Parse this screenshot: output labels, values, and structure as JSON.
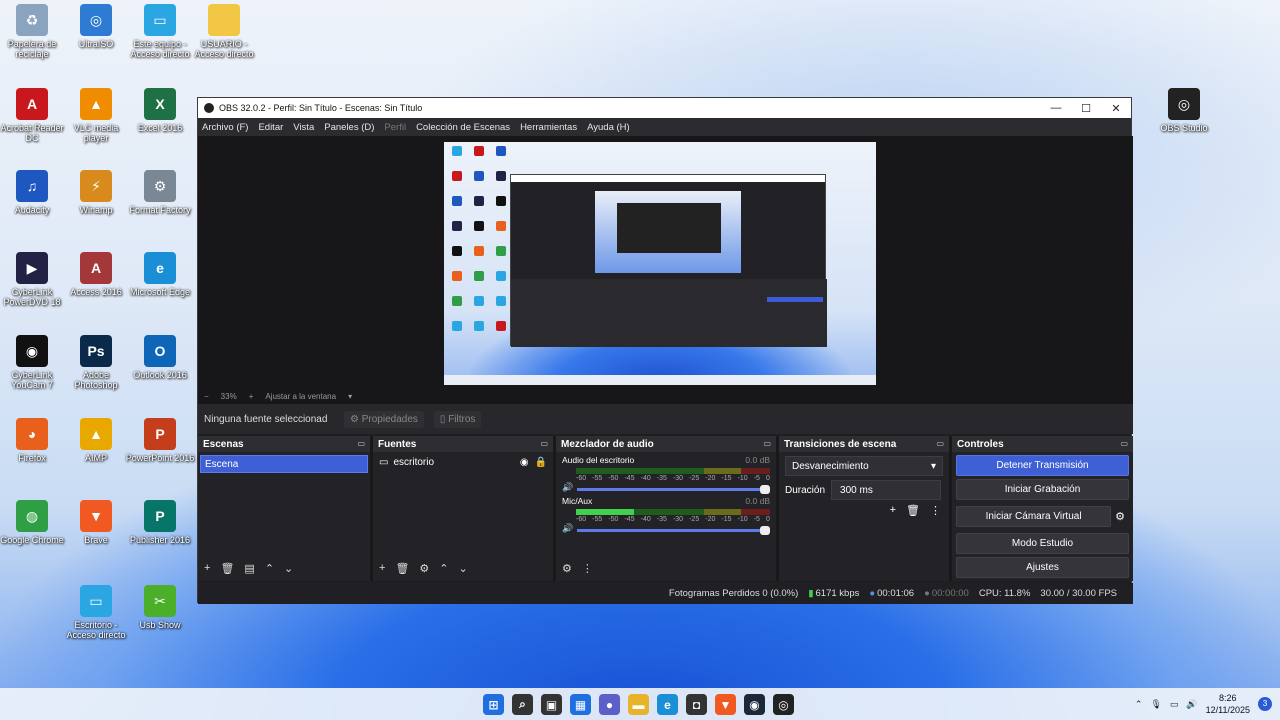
{
  "desktop": {
    "icons": [
      {
        "label": "Papelera de reciclaje",
        "icon": "recycle-bin-icon",
        "color": "#8aa4c0"
      },
      {
        "label": "UltraISO",
        "icon": "ultraiso-icon",
        "color": "#2e7bd4"
      },
      {
        "label": "Este equipo - Acceso directo",
        "icon": "monitor-icon",
        "color": "#2aa6e2"
      },
      {
        "label": "USUARIO - Acceso directo",
        "icon": "folder-icon",
        "color": "#f2c744"
      },
      {
        "label": "Acrobat Reader DC",
        "icon": "acrobat-icon",
        "color": "#c8171d"
      },
      {
        "label": "VLC media player",
        "icon": "vlc-icon",
        "color": "#f08c00"
      },
      {
        "label": "Excel 2016",
        "icon": "excel-icon",
        "color": "#1e7145"
      },
      {
        "label": "Audacity",
        "icon": "audacity-icon",
        "color": "#1f57c0"
      },
      {
        "label": "Winamp",
        "icon": "winamp-icon",
        "color": "#d98a1c"
      },
      {
        "label": "Format Factory",
        "icon": "format-factory-icon",
        "color": "#7a8795"
      },
      {
        "label": "CyberLink PowerDVD 18",
        "icon": "powerdvd-icon",
        "color": "#222244"
      },
      {
        "label": "Access 2016",
        "icon": "access-icon",
        "color": "#a4373a"
      },
      {
        "label": "Microsoft Edge",
        "icon": "edge-icon",
        "color": "#1b8fd6"
      },
      {
        "label": "CyberLink YouCam 7",
        "icon": "youcam-icon",
        "color": "#111111"
      },
      {
        "label": "Adobe Photoshop",
        "icon": "photoshop-icon",
        "color": "#0b2a4a"
      },
      {
        "label": "Outlook 2016",
        "icon": "outlook-icon",
        "color": "#0f65b8"
      },
      {
        "label": "Firefox",
        "icon": "firefox-icon",
        "color": "#e8601c"
      },
      {
        "label": "AIMP",
        "icon": "aimp-icon",
        "color": "#e9a800"
      },
      {
        "label": "PowerPoint 2016",
        "icon": "powerpoint-icon",
        "color": "#c43e1c"
      },
      {
        "label": "Google Chrome",
        "icon": "chrome-icon",
        "color": "#2f9e44"
      },
      {
        "label": "Brave",
        "icon": "brave-icon",
        "color": "#f05a22"
      },
      {
        "label": "Publisher 2016",
        "icon": "publisher-icon",
        "color": "#077568"
      },
      {
        "label": "Escritorio - Acceso directo",
        "icon": "desktop-folder-icon",
        "color": "#2aa6e2"
      },
      {
        "label": "Usb Show",
        "icon": "usb-show-icon",
        "color": "#4caf2a"
      },
      {
        "label": "OBS Studio",
        "icon": "obs-icon",
        "color": "#222222"
      }
    ]
  },
  "window": {
    "title": "OBS 32.0.2 - Perfil: Sin Título - Escenas: Sin Título",
    "minimize": "—",
    "maximize": "☐",
    "close": "✕"
  },
  "menu": [
    "Archivo (F)",
    "Editar",
    "Vista",
    "Paneles (D)",
    "Perfil",
    "Colección de Escenas",
    "Herramientas",
    "Ayuda (H)"
  ],
  "zoom": {
    "minus": "−",
    "value": "33%",
    "plus": "+",
    "fit": "Ajustar a la ventana",
    "dropdown": "▾"
  },
  "source_bar": {
    "no_source": "Ninguna fuente seleccionad",
    "properties": "Propiedades",
    "filters": "Filtros"
  },
  "scenes": {
    "title": "Escenas",
    "items": [
      "Escena"
    ]
  },
  "sources": {
    "title": "Fuentes",
    "items": [
      "escritorio"
    ]
  },
  "mixer": {
    "title": "Mezclador de audio",
    "channels": [
      {
        "name": "Audio del escritorio",
        "db": "0.0 dB",
        "level": 0.0
      },
      {
        "name": "Mic/Aux",
        "db": "0.0 dB",
        "level": 0.3
      }
    ],
    "ticks": [
      "-60",
      "-55",
      "-50",
      "-45",
      "-40",
      "-35",
      "-30",
      "-25",
      "-20",
      "-15",
      "-10",
      "-5",
      "0"
    ]
  },
  "transitions": {
    "title": "Transiciones de escena",
    "selected": "Desvanecimiento",
    "duration_label": "Duración",
    "duration_value": "300 ms"
  },
  "controls": {
    "title": "Controles",
    "stop_stream": "Detener Transmisión",
    "start_record": "Iniciar Grabación",
    "virtual_cam": "Iniciar Cámara Virtual",
    "studio_mode": "Modo Estudio",
    "settings": "Ajustes"
  },
  "status": {
    "dropped": "Fotogramas Perdidos 0 (0.0%)",
    "bitrate": "6171 kbps",
    "stream_time": "00:01:06",
    "rec_time": "00:00:00",
    "cpu": "CPU: 11.8%",
    "fps": "30.00 / 30.00 FPS"
  },
  "taskbar": {
    "apps": [
      {
        "icon": "windows-start-icon",
        "color": "#1f6fe0",
        "glyph": "⊞"
      },
      {
        "icon": "search-icon",
        "color": "#333333",
        "glyph": "⌕"
      },
      {
        "icon": "task-view-icon",
        "color": "#333333",
        "glyph": "▣"
      },
      {
        "icon": "widgets-icon",
        "color": "#1f6fe0",
        "glyph": "▦"
      },
      {
        "icon": "teams-chat-icon",
        "color": "#5b5fc7",
        "glyph": "●"
      },
      {
        "icon": "file-explorer-icon",
        "color": "#e8b32b",
        "glyph": "▬"
      },
      {
        "icon": "edge-icon",
        "color": "#1b8fd6",
        "glyph": "e"
      },
      {
        "icon": "store-icon",
        "color": "#333333",
        "glyph": "◘"
      },
      {
        "icon": "brave-icon",
        "color": "#f05a22",
        "glyph": "▼"
      },
      {
        "icon": "steam-icon",
        "color": "#1b2838",
        "glyph": "◉"
      },
      {
        "icon": "obs-icon",
        "color": "#222222",
        "glyph": "◎"
      }
    ],
    "time": "8:26",
    "date": "12/11/2025",
    "notifications": "3"
  }
}
